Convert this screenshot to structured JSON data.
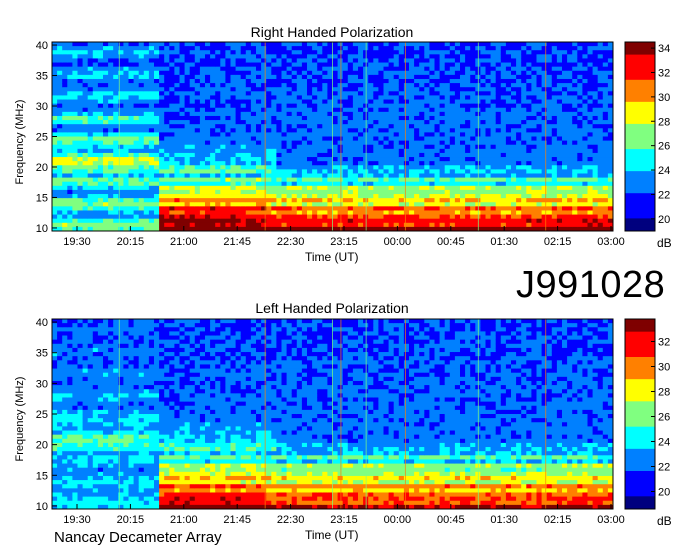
{
  "figure_id": "J991028",
  "footer": "Nancay Decameter Array",
  "colors": {
    "colormap": [
      "#00007f",
      "#0000ff",
      "#0080ff",
      "#00ffff",
      "#80ff80",
      "#ffff00",
      "#ff8000",
      "#ff0000",
      "#7f0000"
    ]
  },
  "chart_data": [
    {
      "type": "heatmap",
      "title": "Right Handed Polarization",
      "xlabel": "Time (UT)",
      "ylabel": "Frequency (MHz)",
      "x_ticks": [
        "19:30",
        "20:15",
        "21:00",
        "21:45",
        "22:30",
        "23:15",
        "00:00",
        "00:45",
        "01:30",
        "02:15",
        "03:00"
      ],
      "y_ticks": [
        10,
        15,
        20,
        25,
        30,
        35,
        40
      ],
      "ylim": [
        9.5,
        40.5
      ],
      "colorbar": {
        "label": "dB",
        "ticks": [
          20,
          22,
          24,
          26,
          28,
          30,
          32,
          34
        ],
        "range": [
          19,
          34.5
        ]
      }
    },
    {
      "type": "heatmap",
      "title": "Left Handed Polarization",
      "xlabel": "Time (UT)",
      "ylabel": "Frequency (MHz)",
      "x_ticks": [
        "19:30",
        "20:15",
        "21:00",
        "21:45",
        "22:30",
        "23:15",
        "00:00",
        "00:45",
        "01:30",
        "02:15",
        "03:00"
      ],
      "y_ticks": [
        10,
        15,
        20,
        25,
        30,
        35,
        40
      ],
      "ylim": [
        9.5,
        40.5
      ],
      "colorbar": {
        "label": "dB",
        "ticks": [
          20,
          22,
          24,
          26,
          28,
          30,
          32
        ],
        "range": [
          18.6,
          33.8
        ]
      }
    }
  ]
}
